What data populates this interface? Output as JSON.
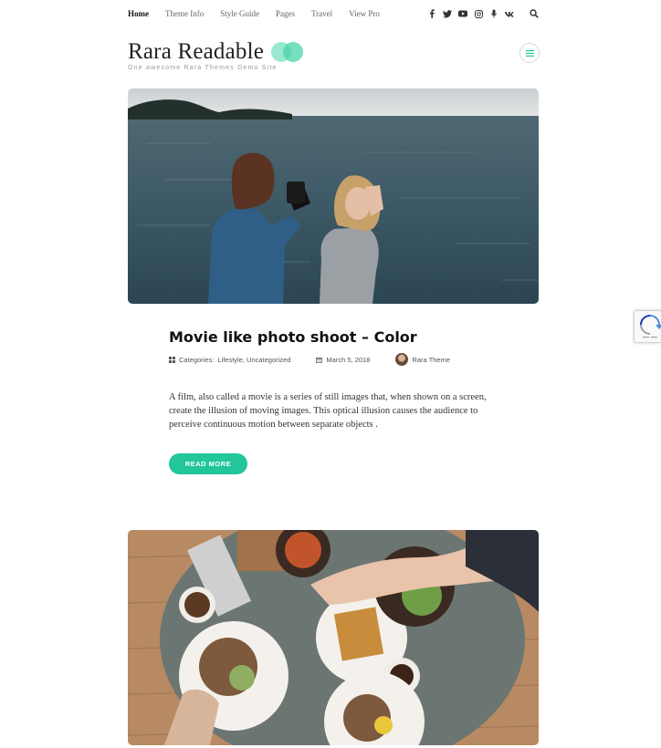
{
  "nav": {
    "items": [
      {
        "label": "Home",
        "active": true
      },
      {
        "label": "Theme Info",
        "active": false
      },
      {
        "label": "Style Guide",
        "active": false
      },
      {
        "label": "Pages",
        "active": false
      },
      {
        "label": "Travel",
        "active": false
      },
      {
        "label": "View Pro",
        "active": false
      }
    ],
    "social": [
      {
        "icon": "facebook-icon",
        "glyph": "f"
      },
      {
        "icon": "twitter-icon",
        "glyph": "t"
      },
      {
        "icon": "youtube-icon",
        "glyph": "▶"
      },
      {
        "icon": "instagram-icon",
        "glyph": "◎"
      },
      {
        "icon": "mic-icon",
        "glyph": "ı"
      },
      {
        "icon": "vk-icon",
        "glyph": "vk"
      }
    ]
  },
  "brand": {
    "title": "Rara Readable",
    "tagline": "One awesome Rara Themes Demo Site",
    "accent": "#48d6aa"
  },
  "post": {
    "title": "Movie like photo shoot – Color",
    "categories_label": "Categories:",
    "categories": "Lifestyle, Uncategorized",
    "date": "March 5, 2018",
    "author": "Rara Theme",
    "excerpt": "A film, also called a movie is a series of still images that, when shown on a screen, create the illusion of moving images. This optical illusion causes the audience to perceive continuous motion between separate objects .",
    "read_more": "READ MORE",
    "button_color": "#23c59a"
  }
}
